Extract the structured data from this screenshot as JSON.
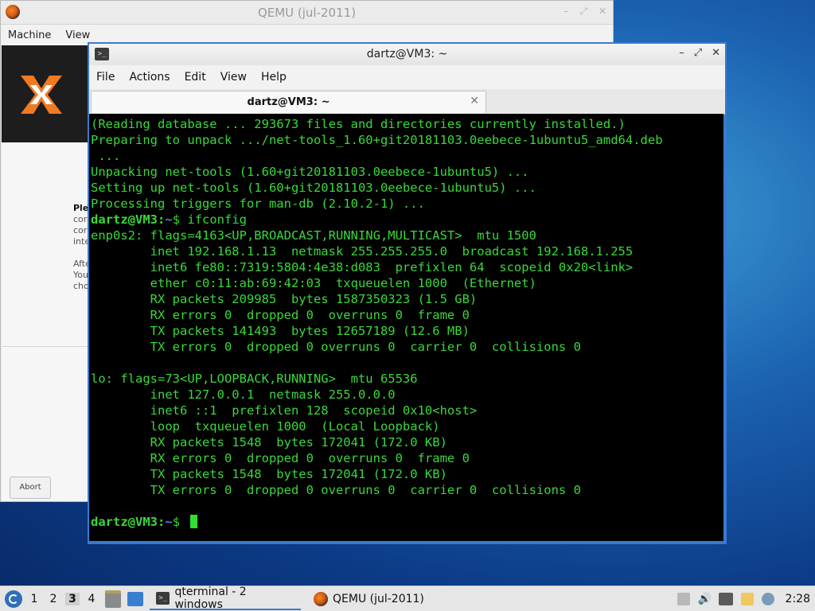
{
  "qemu": {
    "title": "QEMU (jul-2011)",
    "menu": [
      "Machine",
      "View"
    ],
    "guest_text": {
      "heading": "Ple",
      "line1": "cor",
      "line2": "cor",
      "line3": "inte",
      "line4": "Afte",
      "line5": "You",
      "line6": "cho"
    },
    "abort_label": "Abort"
  },
  "terminal": {
    "title": "dartz@VM3: ~",
    "menu": [
      "File",
      "Actions",
      "Edit",
      "View",
      "Help"
    ],
    "tab_label": "dartz@VM3: ~",
    "prompt": {
      "user": "dartz@VM3",
      "sep": ":",
      "path": "~",
      "dollar": "$ "
    },
    "output_before": [
      "(Reading database ... 293673 files and directories currently installed.)",
      "Preparing to unpack .../net-tools_1.60+git20181103.0eebece-1ubuntu5_amd64.deb",
      " ...",
      "Unpacking net-tools (1.60+git20181103.0eebece-1ubuntu5) ...",
      "Setting up net-tools (1.60+git20181103.0eebece-1ubuntu5) ...",
      "Processing triggers for man-db (2.10.2-1) ..."
    ],
    "command": "ifconfig",
    "output_after": [
      "enp0s2: flags=4163<UP,BROADCAST,RUNNING,MULTICAST>  mtu 1500",
      "        inet 192.168.1.13  netmask 255.255.255.0  broadcast 192.168.1.255",
      "        inet6 fe80::7319:5804:4e38:d083  prefixlen 64  scopeid 0x20<link>",
      "        ether c0:11:ab:69:42:03  txqueuelen 1000  (Ethernet)",
      "        RX packets 209985  bytes 1587350323 (1.5 GB)",
      "        RX errors 0  dropped 0  overruns 0  frame 0",
      "        TX packets 141493  bytes 12657189 (12.6 MB)",
      "        TX errors 0  dropped 0 overruns 0  carrier 0  collisions 0",
      "",
      "lo: flags=73<UP,LOOPBACK,RUNNING>  mtu 65536",
      "        inet 127.0.0.1  netmask 255.0.0.0",
      "        inet6 ::1  prefixlen 128  scopeid 0x10<host>",
      "        loop  txqueuelen 1000  (Local Loopback)",
      "        RX packets 1548  bytes 172041 (172.0 KB)",
      "        RX errors 0  dropped 0  overruns 0  frame 0",
      "        TX packets 1548  bytes 172041 (172.0 KB)",
      "        TX errors 0  dropped 0 overruns 0  carrier 0  collisions 0",
      ""
    ]
  },
  "taskbar": {
    "desktops": [
      "1",
      "2",
      "3",
      "4"
    ],
    "active_desktop": "3",
    "tasks": [
      {
        "label": "qterminal - 2 windows",
        "icon": "terminal-icon"
      },
      {
        "label": "QEMU (jul-2011)",
        "icon": "qemu-icon"
      }
    ],
    "clock": "2:28"
  },
  "colors": {
    "terminal_fg": "#3ad83a",
    "prompt_path": "#5b7cf0",
    "accent": "#3a7ad0"
  }
}
